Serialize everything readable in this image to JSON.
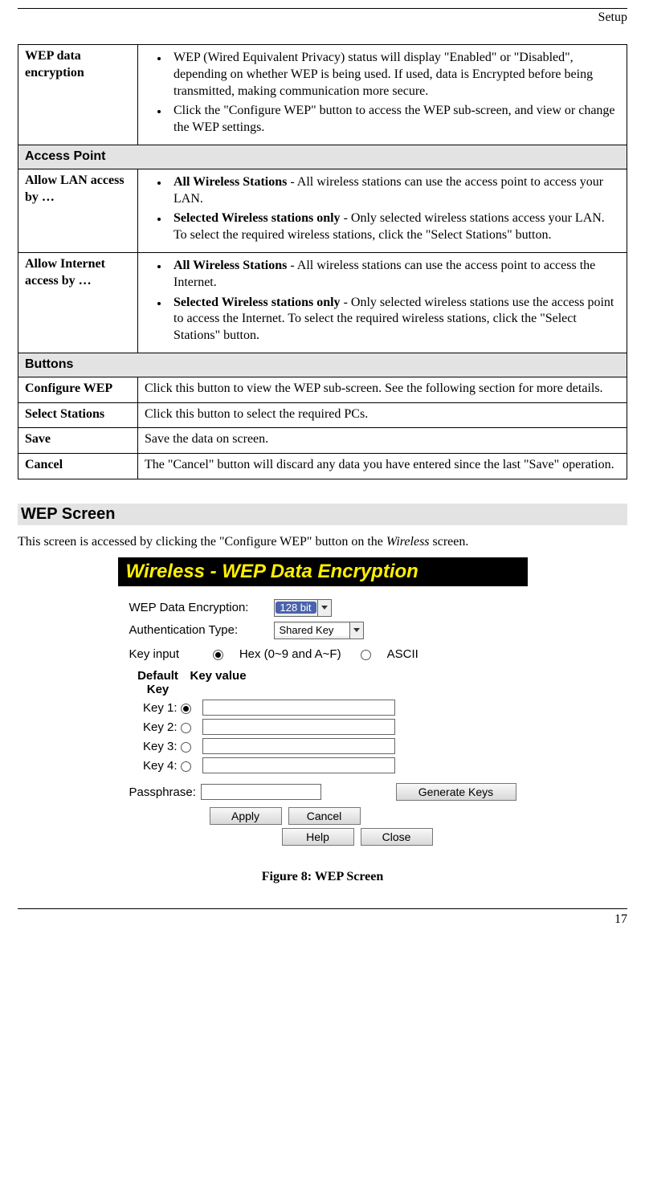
{
  "header": {
    "section": "Setup"
  },
  "table": {
    "row_wep": {
      "label": "WEP data encryption",
      "b1": "WEP (Wired Equivalent Privacy) status will display \"Enabled\" or \"Disabled\", depending on whether WEP is being used. If used, data is Encrypted before being transmitted, making communication more secure.",
      "b2": "Click the \"Configure WEP\" button to access the WEP sub-screen, and view or change the WEP settings."
    },
    "sec_ap": "Access Point",
    "row_lan": {
      "label": "Allow LAN access by …",
      "b1_bold": "All Wireless Stations",
      "b1_rest": " - All wireless stations can use the access point to access your LAN.",
      "b2_bold": "Selected Wireless stations only",
      "b2_rest": " - Only selected wireless stations access your LAN. To select the required wireless stations, click the \"Select Stations\" button."
    },
    "row_net": {
      "label": "Allow Internet access by …",
      "b1_bold": "All Wireless Stations",
      "b1_rest": " - All wireless stations can use the access point to access the Internet.",
      "b2_bold": "Selected Wireless stations only",
      "b2_rest": " - Only selected wireless stations use the access point to access the Internet. To select the required wireless stations, click the \"Select Stations\" button."
    },
    "sec_buttons": "Buttons",
    "row_cfg": {
      "label": "Configure WEP",
      "text": "Click this button to view the WEP sub-screen. See the following section for more details."
    },
    "row_selst": {
      "label": "Select Stations",
      "text": "Click this button to select the required PCs."
    },
    "row_save": {
      "label": "Save",
      "text": "Save the data on screen."
    },
    "row_cancel": {
      "label": "Cancel",
      "text": "The \"Cancel\" button will discard any data you have entered since the last \"Save\" operation."
    }
  },
  "heading": "WEP Screen",
  "intro_pre": "This screen is accessed by clicking the \"Configure WEP\" button on the ",
  "intro_ital": "Wireless",
  "intro_post": " screen.",
  "wep": {
    "title": "Wireless - WEP Data Encryption",
    "enc_label": "WEP Data Encryption:",
    "enc_value": "128 bit",
    "auth_label": "Authentication Type:",
    "auth_value": "Shared Key",
    "keyinput_label": "Key input",
    "hex": "Hex (0~9 and A~F)",
    "ascii": "ASCII",
    "hdr_default": "Default Key",
    "hdr_value": "Key value",
    "k1": "Key 1:",
    "k2": "Key 2:",
    "k3": "Key 3:",
    "k4": "Key 4:",
    "pass_label": "Passphrase:",
    "btn_gen": "Generate Keys",
    "btn_apply": "Apply",
    "btn_cancel": "Cancel",
    "btn_help": "Help",
    "btn_close": "Close"
  },
  "figure_caption": "Figure 8: WEP Screen",
  "page_number": "17"
}
